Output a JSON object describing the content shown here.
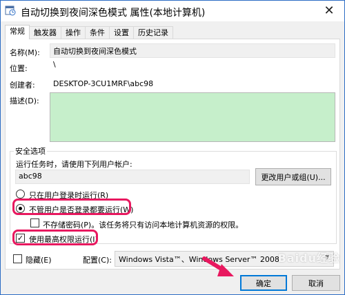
{
  "window": {
    "title": "自动切换到夜间深色模式 属性(本地计算机)",
    "close_glyph": "✕"
  },
  "tabs": [
    {
      "label": "常规",
      "active": true
    },
    {
      "label": "触发器"
    },
    {
      "label": "操作"
    },
    {
      "label": "条件"
    },
    {
      "label": "设置"
    },
    {
      "label": "历史记录"
    }
  ],
  "general": {
    "name_label": "名称(M):",
    "name_value": "自动切换到夜间深色模式",
    "location_label": "位置:",
    "location_value": "\\",
    "author_label": "创建者:",
    "author_value": "DESKTOP-3CU1MRF\\abc98",
    "description_label": "描述(D):"
  },
  "security": {
    "group_title": "安全选项",
    "run_as_prompt": "运行任务时，请使用下列用户帐户:",
    "user_account": "abc98",
    "change_user_button": "更改用户或组(U)...",
    "radio_logged_on": "只在用户登录时运行(R)",
    "radio_whether_logged_on": "不管用户是否登录都要运行(W)",
    "no_store_password": "不存储密码(P)。该任务将只有访问本地计算机资源的权限。",
    "highest_privileges": "使用最高权限运行(I)"
  },
  "bottom": {
    "hidden_label": "隐藏(E)",
    "configure_label": "配置(C):",
    "configure_value": "Windows Vista™、Windows Server™ 2008"
  },
  "buttons": {
    "ok": "确定",
    "cancel": "取消"
  },
  "colors": {
    "highlight": "#e8185f",
    "description_fill": "#c6efcb",
    "accent": "#0078d7"
  },
  "watermark": "Baidu经验"
}
